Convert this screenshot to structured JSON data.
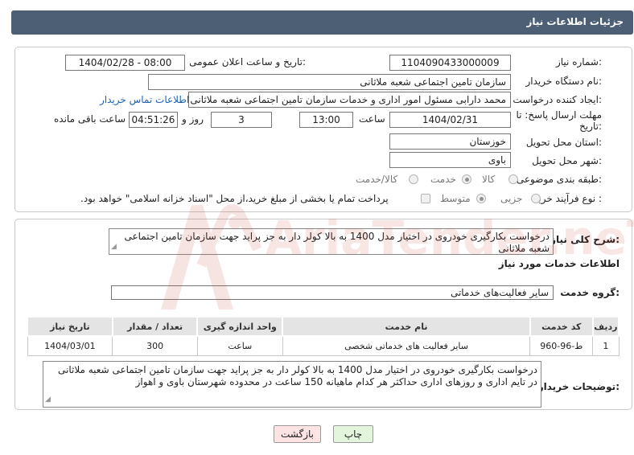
{
  "header": {
    "title": "جزئیات اطلاعات نیاز"
  },
  "need_info": {
    "need_number_label": "شماره نیاز:",
    "need_number": "1104090433000009",
    "announce_label": "تاریخ و ساعت اعلان عمومی:",
    "announce_value": "1404/02/28 - 08:00",
    "buyer_label": "نام دستگاه خریدار:",
    "buyer_value": "سازمان تامین اجتماعی شعبه ملاثانی",
    "creator_label": "ایجاد کننده درخواست:",
    "creator_value": "محمد دارابی مسئول امور اداری و خدمات سازمان تامین اجتماعی شعبه ملاثانی",
    "contact_link": "اطلاعات تماس خریدار",
    "deadline_label_1": "مهلت ارسال پاسخ: تا",
    "deadline_label_2": "تاریخ:",
    "deadline_date": "1404/02/31",
    "time_label": "ساعت",
    "deadline_time": "13:00",
    "days_value": "3",
    "days_label": "روز و",
    "remaining_value": "04:51:26",
    "remaining_label": "ساعت باقی مانده",
    "province_label": "استان محل تحویل:",
    "province_value": "خوزستان",
    "city_label": "شهر محل تحویل:",
    "city_value": "باوی",
    "category_label": "طبقه بندی موضوعی:",
    "category_options": [
      "کالا",
      "خدمت",
      "کالا/خدمت"
    ],
    "category_selected": "خدمت",
    "process_label": "نوع فرآیند خرید :",
    "process_options": [
      "جزیی",
      "متوسط"
    ],
    "process_selected": "متوسط",
    "payment_note": "پرداخت تمام یا بخشی از مبلغ خرید،از محل \"اسناد خزانه اسلامی\" خواهد بود."
  },
  "summary": {
    "label": "شرح کلی نیاز:",
    "text": "درخواست بکارگیری خودروی در اختیار مدل 1400 به بالا کولر دار به جز پراید جهت سازمان تامین اجتماعی شعبه ملاثانی"
  },
  "services": {
    "section_title": "اطلاعات خدمات مورد نیاز",
    "group_label": "گروه خدمت:",
    "group_value": "سایر فعالیت‌های خدماتی",
    "columns": [
      "ردیف",
      "کد خدمت",
      "نام خدمت",
      "واحد اندازه گیری",
      "تعداد / مقدار",
      "تاریخ نیاز"
    ],
    "rows": [
      [
        "1",
        "ط-96-960",
        "سایر فعالیت های خدماتی شخصی",
        "ساعت",
        "300",
        "1404/03/01"
      ]
    ]
  },
  "buyer_notes": {
    "label": "توضیحات خریدار:",
    "text": "درخواست بکارگیری خودروی در اختیار مدل 1400 به بالا کولر دار به جز پراید جهت سازمان تامین اجتماعی شعبه ملاثانی در تایم اداری و روزهای اداری حداکثر هر کدام ماهیانه 150 ساعت در محدوده شهرستان باوی و اهواز"
  },
  "actions": {
    "print": "چاپ",
    "back": "بازگشت"
  },
  "watermark": {
    "text": "AriaTender.neT"
  },
  "colors": {
    "header_bg": "#4d5f74",
    "link": "#1e61b0",
    "back_bg": "#fde3e3",
    "print_bg": "#e3f5dc"
  }
}
